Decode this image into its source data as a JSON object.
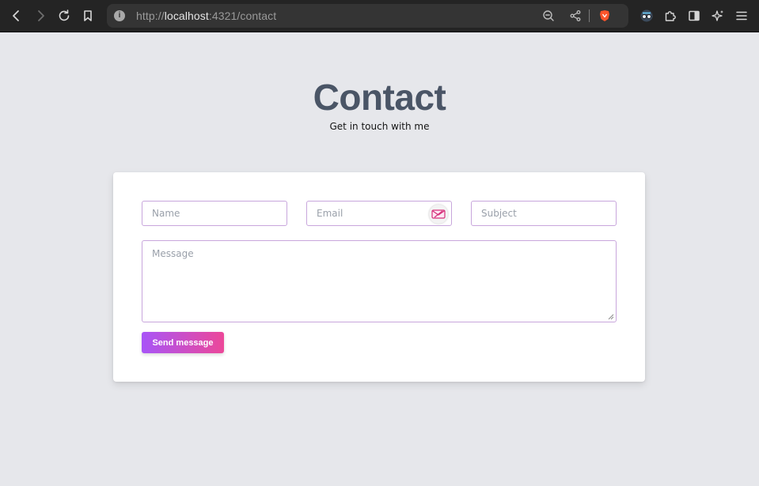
{
  "browser": {
    "url_scheme": "http://",
    "url_host": "localhost",
    "url_path": ":4321/contact",
    "info_glyph": "i",
    "icons": [
      "back-icon",
      "forward-icon",
      "reload-icon",
      "bookmark-icon",
      "zoom-icon",
      "share-icon",
      "brave-shield-icon",
      "extension-avatar-icon",
      "puzzle-icon",
      "sidebar-icon",
      "leo-ai-icon",
      "menu-icon"
    ]
  },
  "page": {
    "title": "Contact",
    "subtitle": "Get in touch with me"
  },
  "form": {
    "name_placeholder": "Name",
    "email_placeholder": "Email",
    "subject_placeholder": "Subject",
    "message_placeholder": "Message",
    "submit_label": "Send message"
  },
  "colors": {
    "page_bg": "#e6e7eb",
    "title": "#4a5566",
    "field_border": "#c8a6dc",
    "button_gradient_start": "#a855f7",
    "button_gradient_end": "#ec4899",
    "toolbar_bg": "#242424"
  }
}
